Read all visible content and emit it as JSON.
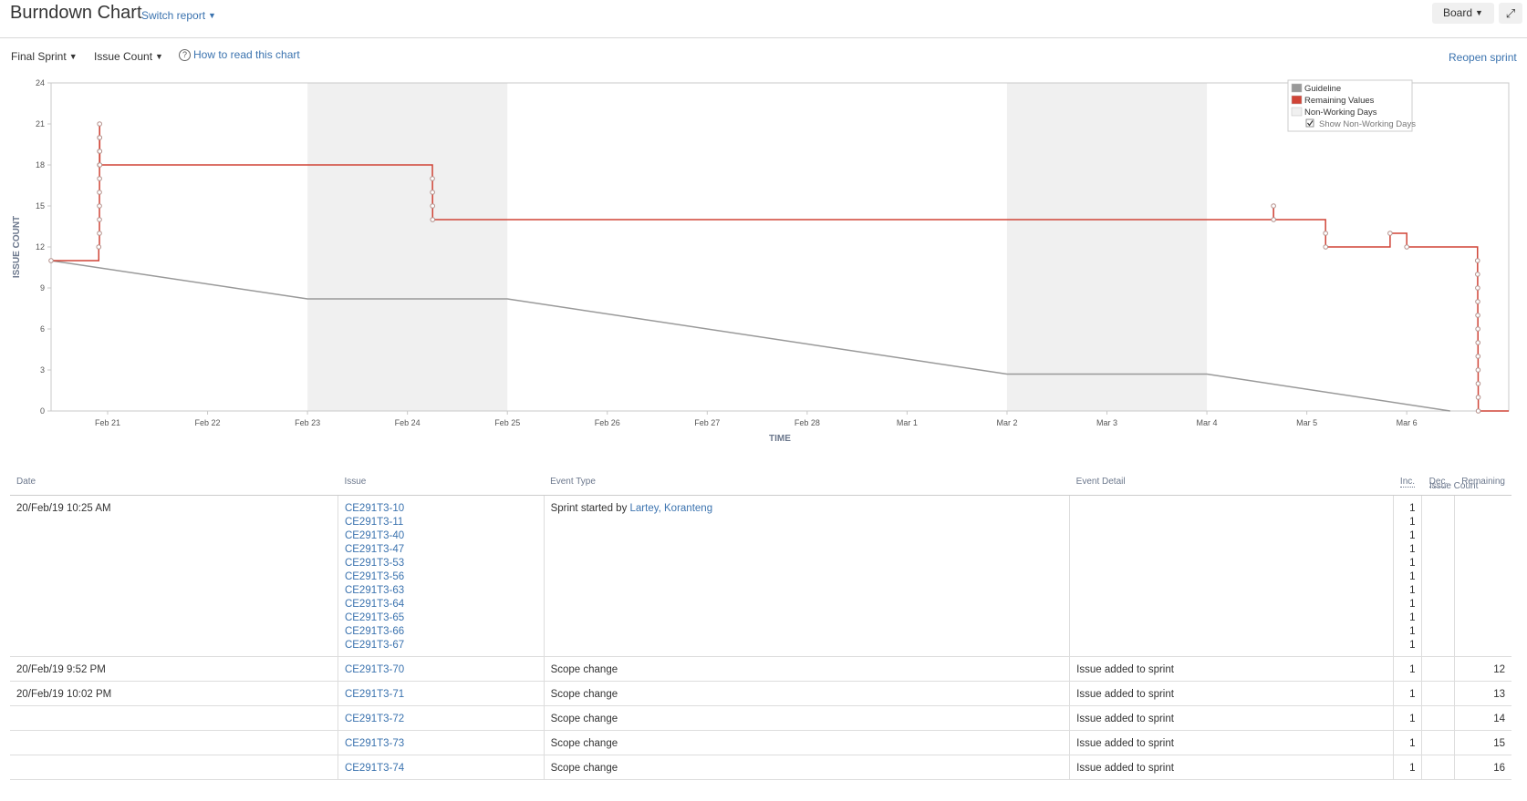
{
  "header": {
    "title": "Burndown Chart",
    "switch_report": "Switch report",
    "board": "Board",
    "expand_icon": "expand-icon"
  },
  "toolbar": {
    "sprint": "Final Sprint",
    "metric": "Issue Count",
    "help": "How to read this chart",
    "reopen": "Reopen sprint"
  },
  "chart_data": {
    "type": "line",
    "xlabel": "TIME",
    "ylabel": "ISSUE COUNT",
    "ylim": [
      0,
      24
    ],
    "yticks": [
      0,
      3,
      6,
      9,
      12,
      15,
      18,
      21,
      24
    ],
    "xticks": [
      "Feb 21",
      "Feb 22",
      "Feb 23",
      "Feb 24",
      "Feb 25",
      "Feb 26",
      "Feb 27",
      "Feb 28",
      "Mar 1",
      "Mar 2",
      "Mar 3",
      "Mar 4",
      "Mar 5",
      "Mar 6"
    ],
    "xlim": [
      "2019-02-20 10:25",
      "2019-03-07 00:30"
    ],
    "non_working_days": [
      [
        "2019-02-23",
        "2019-02-25"
      ],
      [
        "2019-03-02",
        "2019-03-04"
      ]
    ],
    "legend": {
      "position": "top-right",
      "items": [
        {
          "label": "Guideline",
          "color": "#999999"
        },
        {
          "label": "Remaining Values",
          "color": "#d04437"
        },
        {
          "label": "Non-Working Days",
          "color": "#f0f0f0"
        }
      ],
      "checkbox_label": "Show Non-Working Days",
      "checkbox_checked": true
    },
    "series": [
      {
        "name": "Guideline",
        "color": "#999999",
        "points": [
          {
            "x": "2019-02-20 10:25",
            "y": 11
          },
          {
            "x": "2019-02-23 00:00",
            "y": 8.2
          },
          {
            "x": "2019-02-25 00:00",
            "y": 8.2
          },
          {
            "x": "2019-03-02 00:00",
            "y": 2.7
          },
          {
            "x": "2019-03-04 00:00",
            "y": 2.7
          },
          {
            "x": "2019-03-06 10:25",
            "y": 0
          }
        ]
      },
      {
        "name": "Remaining Values",
        "color": "#d04437",
        "steps": [
          {
            "x": "2019-02-20 10:25",
            "y": 11
          },
          {
            "x": "2019-02-20 21:52",
            "y": 12
          },
          {
            "x": "2019-02-20 22:02",
            "y": 13
          },
          {
            "x": "2019-02-20 22:02",
            "y": 14
          },
          {
            "x": "2019-02-20 22:02",
            "y": 15
          },
          {
            "x": "2019-02-20 22:02",
            "y": 16
          },
          {
            "x": "2019-02-20 22:03",
            "y": 17
          },
          {
            "x": "2019-02-20 22:03",
            "y": 18
          },
          {
            "x": "2019-02-20 22:03",
            "y": 19
          },
          {
            "x": "2019-02-20 22:03",
            "y": 20
          },
          {
            "x": "2019-02-20 22:04",
            "y": 21
          },
          {
            "x": "2019-02-20 22:05",
            "y": 20
          },
          {
            "x": "2019-02-20 22:06",
            "y": 19
          },
          {
            "x": "2019-02-20 22:07",
            "y": 18
          },
          {
            "x": "2019-02-24 06:00",
            "y": 17
          },
          {
            "x": "2019-02-24 06:01",
            "y": 16
          },
          {
            "x": "2019-02-24 06:02",
            "y": 15
          },
          {
            "x": "2019-02-24 06:03",
            "y": 14
          },
          {
            "x": "2019-03-04 16:00",
            "y": 15
          },
          {
            "x": "2019-03-04 16:01",
            "y": 14
          },
          {
            "x": "2019-03-05 04:30",
            "y": 13
          },
          {
            "x": "2019-03-05 04:31",
            "y": 12
          },
          {
            "x": "2019-03-05 20:00",
            "y": 13
          },
          {
            "x": "2019-03-06 00:00",
            "y": 12
          },
          {
            "x": "2019-03-06 17:00",
            "y": 11
          },
          {
            "x": "2019-03-06 17:01",
            "y": 10
          },
          {
            "x": "2019-03-06 17:02",
            "y": 9
          },
          {
            "x": "2019-03-06 17:03",
            "y": 8
          },
          {
            "x": "2019-03-06 17:04",
            "y": 7
          },
          {
            "x": "2019-03-06 17:05",
            "y": 6
          },
          {
            "x": "2019-03-06 17:06",
            "y": 5
          },
          {
            "x": "2019-03-06 17:07",
            "y": 4
          },
          {
            "x": "2019-03-06 17:08",
            "y": 3
          },
          {
            "x": "2019-03-06 17:09",
            "y": 2
          },
          {
            "x": "2019-03-06 17:10",
            "y": 1
          },
          {
            "x": "2019-03-06 17:11",
            "y": 0
          },
          {
            "x": "2019-03-07 00:30",
            "y": 0
          }
        ]
      }
    ]
  },
  "table": {
    "group_header": "Issue Count",
    "columns": {
      "date": "Date",
      "issue": "Issue",
      "event_type": "Event Type",
      "event_detail": "Event Detail",
      "inc": "Inc.",
      "dec": "Dec.",
      "remaining": "Remaining"
    },
    "rows": [
      {
        "date": "20/Feb/19 10:25 AM",
        "issues": [
          "CE291T3-10",
          "CE291T3-11",
          "CE291T3-40",
          "CE291T3-47",
          "CE291T3-53",
          "CE291T3-56",
          "CE291T3-63",
          "CE291T3-64",
          "CE291T3-65",
          "CE291T3-66",
          "CE291T3-67"
        ],
        "event_prefix": "Sprint started by ",
        "event_user": "Lartey, Koranteng",
        "detail": "",
        "inc": [
          "1",
          "1",
          "1",
          "1",
          "1",
          "1",
          "1",
          "1",
          "1",
          "1",
          "1"
        ],
        "dec": "",
        "remaining": ""
      },
      {
        "date": "20/Feb/19 9:52 PM",
        "issues": [
          "CE291T3-70"
        ],
        "event_prefix": "Scope change",
        "event_user": "",
        "detail": "Issue added to sprint",
        "inc": [
          "1"
        ],
        "dec": "",
        "remaining": "12"
      },
      {
        "date": "20/Feb/19 10:02 PM",
        "issues": [
          "CE291T3-71"
        ],
        "event_prefix": "Scope change",
        "event_user": "",
        "detail": "Issue added to sprint",
        "inc": [
          "1"
        ],
        "dec": "",
        "remaining": "13"
      },
      {
        "date": "",
        "issues": [
          "CE291T3-72"
        ],
        "event_prefix": "Scope change",
        "event_user": "",
        "detail": "Issue added to sprint",
        "inc": [
          "1"
        ],
        "dec": "",
        "remaining": "14"
      },
      {
        "date": "",
        "issues": [
          "CE291T3-73"
        ],
        "event_prefix": "Scope change",
        "event_user": "",
        "detail": "Issue added to sprint",
        "inc": [
          "1"
        ],
        "dec": "",
        "remaining": "15"
      },
      {
        "date": "",
        "issues": [
          "CE291T3-74"
        ],
        "event_prefix": "Scope change",
        "event_user": "",
        "detail": "Issue added to sprint",
        "inc": [
          "1"
        ],
        "dec": "",
        "remaining": "16"
      }
    ]
  }
}
